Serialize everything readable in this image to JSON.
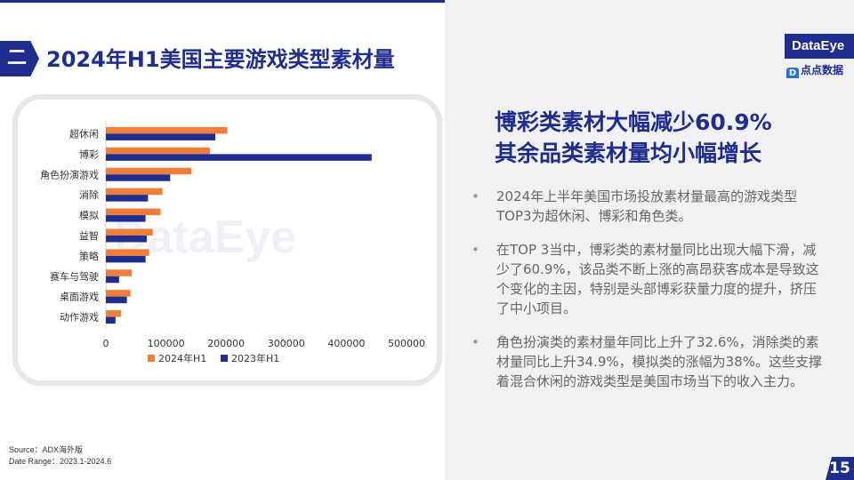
{
  "header": {
    "badge": "二",
    "title": "2024年H1美国主要游戏类型素材量"
  },
  "logo": {
    "brand": "DataEye",
    "sub_mark": "D",
    "sub_name": "点点数据"
  },
  "headline": {
    "line1": "博彩类素材大幅减少60.9%",
    "line2": "其余品类素材量均小幅增长"
  },
  "bullets": [
    "2024年上半年美国市场投放素材量最高的游戏类型TOP3为超休闲、博彩和角色类。",
    "在TOP 3当中，博彩类的素材量同比出现大幅下滑，减少了60.9%，该品类不断上涨的高昂获客成本是导致这个变化的主因，特别是头部博彩获量力度的提升，挤压了中小项目。",
    "角色扮演类的素材量年同比上升了32.6%，消除类的素材量同比上升34.9%，模拟类的涨幅为38%。这些支撑着混合休闲的游戏类型是美国市场当下的收入主力。"
  ],
  "source": {
    "line1": "Source：ADX海外版",
    "line2": "Date Range：2023.1-2024.6"
  },
  "page_number": "15",
  "colors": {
    "brand_navy": "#1f2d8f",
    "series_2024": "#f07e3a",
    "series_2023": "#1f2d8f"
  },
  "chart_data": {
    "type": "bar",
    "orientation": "horizontal",
    "watermark": "DataEye",
    "categories": [
      "超休闲",
      "博彩",
      "角色扮演游戏",
      "消除",
      "模拟",
      "益智",
      "策略",
      "赛车与驾驶",
      "桌面游戏",
      "动作游戏"
    ],
    "series": [
      {
        "name": "2024年H1",
        "color": "#f07e3a",
        "values": [
          202000,
          173000,
          142000,
          94000,
          91000,
          78000,
          72000,
          43000,
          41000,
          25000
        ]
      },
      {
        "name": "2023年H1",
        "color": "#1f2d8f",
        "values": [
          182000,
          442000,
          107000,
          70000,
          66000,
          68000,
          66000,
          22000,
          35000,
          16000
        ]
      }
    ],
    "x_ticks": [
      0,
      100000,
      200000,
      300000,
      400000,
      500000
    ],
    "xlim": [
      0,
      500000
    ],
    "grid": false,
    "legend_position": "bottom"
  }
}
